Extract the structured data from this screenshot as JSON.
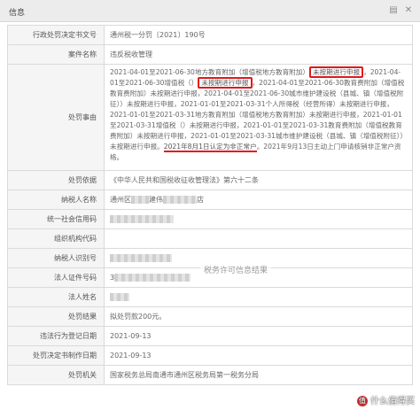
{
  "window": {
    "title": "信息",
    "icons": [
      "print-icon",
      "close-icon"
    ]
  },
  "rows": {
    "doc_no": {
      "label": "行政处罚决定书文号",
      "value": "通州税一分罚〔2021〕190号"
    },
    "case_name": {
      "label": "案件名称",
      "value": "违反税收管理"
    },
    "reason": {
      "label": "处罚事由",
      "parts": [
        "2021-04-01至2021-06-30地方教育附加（增值税地方教育附加）",
        "未按期进行申报",
        "，2021-04-01至2021-06-30增值税（）",
        "未按期进行申报",
        "，2021-04-01至2021-06-30教育费附加（增值税教育费附加）未按期进行申报，2021-04-01至2021-06-30城市维护建设税（县城、镇（增值税附征））未按期进行申报，2021-01-01至2021-03-31个人所得税（经营所得）未按期进行申报，2021-01-01至2021-03-31地方教育附加（增值税地方教育附加）未按期进行申报，2021-01-01至2021-03-31增值税（）未按期进行申报，2021-01-01至2021-03-31教育费附加（增值税教育费附加）未按期进行申报，2021-01-01至2021-03-31城市维护建设税（县城、镇（增值税附征））未按期进行申报。",
        "2021年8月1日认定为非正常户",
        "。2021年9月13日主动上门申请核销非正常户资格。"
      ]
    },
    "basis": {
      "label": "处罚依据",
      "value": "《中华人民共和国税收征收管理法》第六十二条"
    },
    "taxpayer_name": {
      "label": "纳税人名称",
      "value_prefix": "通州区",
      "value_middle": "建伟",
      "value_suffix": "店"
    },
    "credit_code": {
      "label": "统一社会信用码"
    },
    "org_code": {
      "label": "组织机构代码"
    },
    "taxpayer_id": {
      "label": "纳税人识别号"
    },
    "legal_cert": {
      "label": "法人证件号码",
      "value_prefix": "3"
    },
    "legal_name": {
      "label": "法人姓名"
    },
    "result": {
      "label": "处罚结果",
      "value": "拟处罚款200元。"
    },
    "violation_date": {
      "label": "违法行为登记日期",
      "value": "2021-09-13"
    },
    "decision_date": {
      "label": "处罚决定书制作日期",
      "value": "2021-09-13"
    },
    "authority": {
      "label": "处罚机关",
      "value": "国家税务总局南通市通州区税务局第一税务分局"
    }
  },
  "watermark": "税务许可信息结果",
  "credit": "什么值得买",
  "colors": {
    "highlight": "#e0191c",
    "label_bg": "#f5f5f5",
    "border": "#dadada"
  }
}
